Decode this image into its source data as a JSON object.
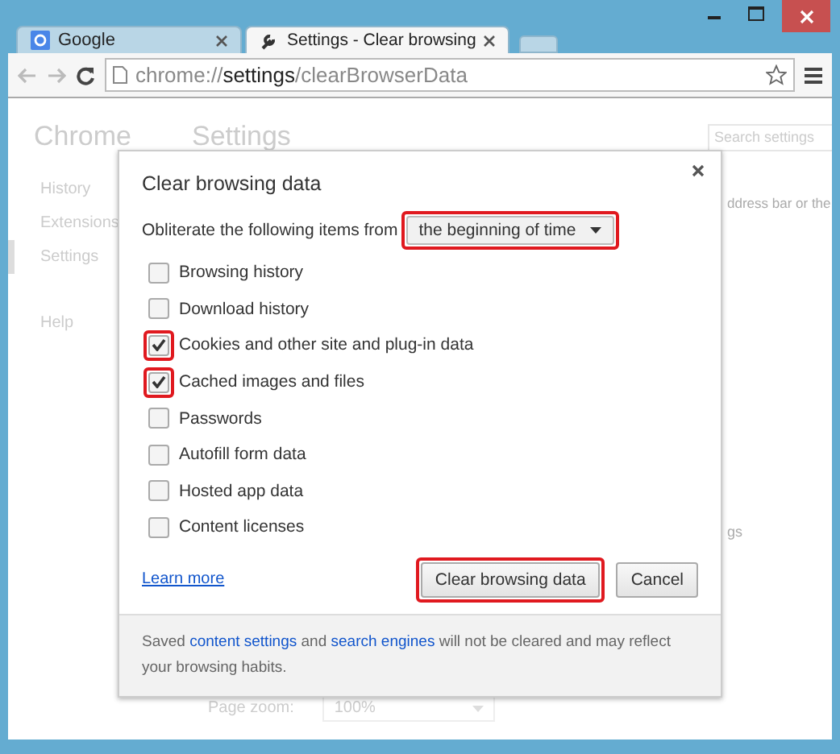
{
  "tabs": [
    {
      "label": "Google",
      "selected": false
    },
    {
      "label": "Settings - Clear browsing",
      "selected": true
    }
  ],
  "address": {
    "scheme": "chrome://",
    "host": "settings",
    "path": "/clearBrowserData"
  },
  "page": {
    "brand": "Chrome",
    "heading": "Settings",
    "search": {
      "placeholder": "Search settings"
    },
    "sidebar": [
      {
        "label": "History",
        "selected": false
      },
      {
        "label": "Extensions",
        "selected": false
      },
      {
        "label": "Settings",
        "selected": true
      },
      {
        "label": "Help",
        "selected": false
      }
    ],
    "fragment_1": "ddress bar or the",
    "fragment_2": "gs",
    "zoom": {
      "label": "Page zoom:",
      "value": "100%"
    }
  },
  "dialog": {
    "title": "Clear browsing data",
    "period_label": "Obliterate the following items from",
    "period": {
      "value": "the beginning of time",
      "highlighted": true
    },
    "items": [
      {
        "label": "Browsing history",
        "checked": false,
        "highlighted": false
      },
      {
        "label": "Download history",
        "checked": false,
        "highlighted": false
      },
      {
        "label": "Cookies and other site and plug-in data",
        "checked": true,
        "highlighted": true
      },
      {
        "label": "Cached images and files",
        "checked": true,
        "highlighted": true
      },
      {
        "label": "Passwords",
        "checked": false,
        "highlighted": false
      },
      {
        "label": "Autofill form data",
        "checked": false,
        "highlighted": false
      },
      {
        "label": "Hosted app data",
        "checked": false,
        "highlighted": false
      },
      {
        "label": "Content licenses",
        "checked": false,
        "highlighted": false
      }
    ],
    "learn_more": "Learn more",
    "buttons": [
      {
        "label": "Clear browsing data",
        "highlighted": true
      },
      {
        "label": "Cancel",
        "highlighted": false
      }
    ],
    "footer": [
      {
        "kind": "text",
        "text": "Saved "
      },
      {
        "kind": "link",
        "text": "content settings"
      },
      {
        "kind": "text",
        "text": " and "
      },
      {
        "kind": "link",
        "text": "search engines"
      },
      {
        "kind": "text",
        "text": " will not be cleared and may reflect your browsing habits."
      }
    ]
  }
}
